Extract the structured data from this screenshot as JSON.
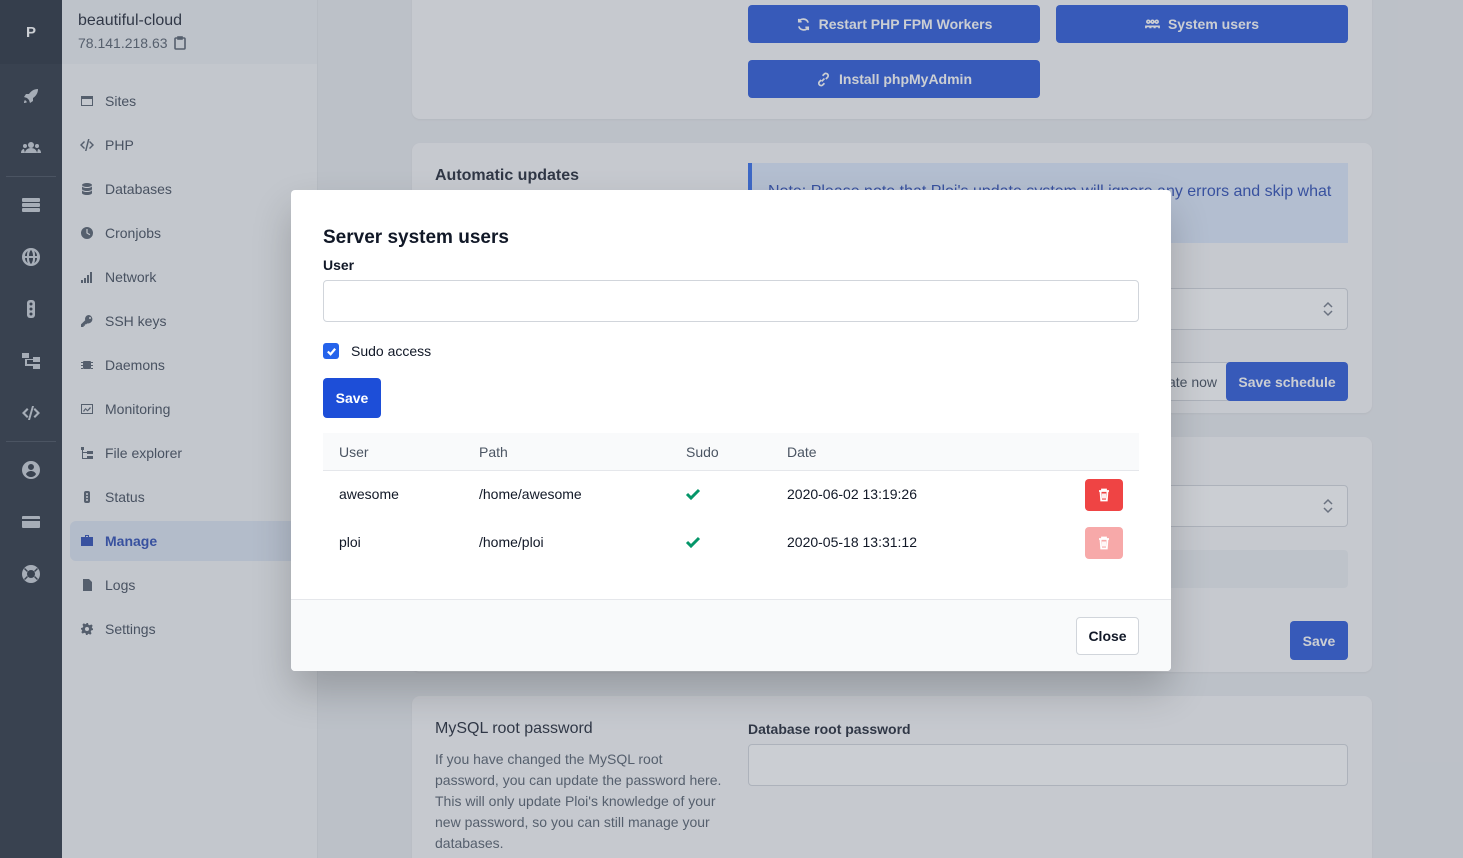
{
  "app": {
    "logo_letter": "P"
  },
  "rail": {
    "icons": [
      "rocket-icon",
      "users-icon",
      "servers-icon",
      "globe-icon",
      "traffic-light-icon",
      "network-tree-icon",
      "code-icon",
      "user-circle-icon",
      "credit-card-icon",
      "lifebuoy-icon"
    ]
  },
  "server": {
    "name": "beautiful-cloud",
    "ip": "78.141.218.63"
  },
  "sidebar": {
    "items": [
      {
        "label": "Sites",
        "icon": "window-icon"
      },
      {
        "label": "PHP",
        "icon": "code-icon"
      },
      {
        "label": "Databases",
        "icon": "database-icon"
      },
      {
        "label": "Cronjobs",
        "icon": "clock-icon"
      },
      {
        "label": "Network",
        "icon": "signal-bars-icon"
      },
      {
        "label": "SSH keys",
        "icon": "key-icon"
      },
      {
        "label": "Daemons",
        "icon": "chip-icon"
      },
      {
        "label": "Monitoring",
        "icon": "chart-icon"
      },
      {
        "label": "File explorer",
        "icon": "folder-tree-icon"
      },
      {
        "label": "Status",
        "icon": "traffic-light-icon"
      },
      {
        "label": "Manage",
        "icon": "briefcase-icon",
        "active": true
      },
      {
        "label": "Logs",
        "icon": "file-icon"
      },
      {
        "label": "Settings",
        "icon": "gear-icon"
      }
    ]
  },
  "main": {
    "restart_php_label": "Restart PHP FPM Workers",
    "system_users_label": "System users",
    "install_phpmyadmin_label": "Install phpMyAdmin",
    "auto_updates_title": "Automatic updates",
    "auto_updates_note": "Note: Please note that Ploi's update system will ignore any errors and skip what could occur.",
    "update_now_label": "Update now",
    "save_schedule_label": "Save schedule",
    "save_label": "Save",
    "mysql_title": "MySQL root password",
    "mysql_description": "If you have changed the MySQL root password, you can update the password here. This will only update Ploi's knowledge of your new password, so you can still manage your databases.",
    "db_root_password_label": "Database root password"
  },
  "modal": {
    "title": "Server system users",
    "user_label": "User",
    "user_value": "",
    "sudo_label": "Sudo access",
    "sudo_checked": true,
    "save_label": "Save",
    "columns": [
      "User",
      "Path",
      "Sudo",
      "Date"
    ],
    "rows": [
      {
        "user": "awesome",
        "path": "/home/awesome",
        "sudo": true,
        "date": "2020-06-02 13:19:26",
        "delete_enabled": true
      },
      {
        "user": "ploi",
        "path": "/home/ploi",
        "sudo": true,
        "date": "2020-05-18 13:31:12",
        "delete_enabled": false
      }
    ],
    "close_label": "Close"
  },
  "colors": {
    "primary": "#1d4ed8",
    "danger": "#ef4444",
    "success": "#059669",
    "rail_bg": "#1f2937"
  }
}
